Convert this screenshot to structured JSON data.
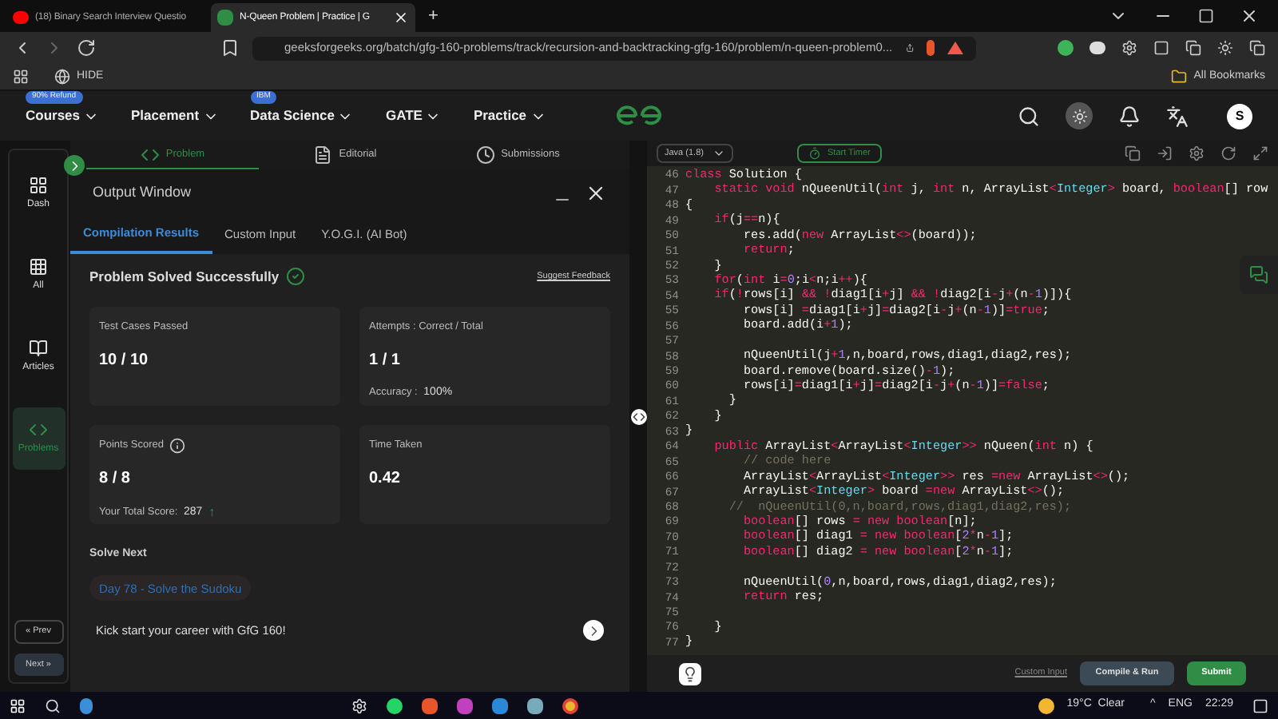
{
  "browser": {
    "tabs": [
      {
        "title": "(18) Binary Search Interview Questio",
        "selected": false
      },
      {
        "title": "N-Queen Problem | Practice | G",
        "selected": true
      }
    ],
    "new_tab": "+",
    "url": "geeksforgeeks.org/batch/gfg-160-problems/track/recursion-and-backtracking-gfg-160/problem/n-queen-problem0...",
    "bookmarks": {
      "left": "HIDE",
      "right": "All Bookmarks"
    }
  },
  "site_nav": {
    "items": [
      {
        "label": "Courses",
        "badge": "90% Refund"
      },
      {
        "label": "Placement"
      },
      {
        "label": "Data Science",
        "badge": "IBM"
      },
      {
        "label": "GATE"
      },
      {
        "label": "Practice"
      }
    ],
    "avatar": "S"
  },
  "sidebar": {
    "items": [
      {
        "label": "Dash",
        "kind": "dash",
        "selected": false
      },
      {
        "label": "All",
        "kind": "all",
        "selected": false
      },
      {
        "label": "Articles",
        "kind": "articles",
        "selected": false
      },
      {
        "label": "Problems",
        "kind": "problems",
        "selected": true
      }
    ],
    "prev": "« Prev",
    "next": "Next »"
  },
  "problem_tabs": [
    {
      "label": "Problem",
      "kind": "code",
      "selected": true
    },
    {
      "label": "Editorial",
      "kind": "doc",
      "selected": false
    },
    {
      "label": "Submissions",
      "kind": "clock",
      "selected": false
    }
  ],
  "output_window": {
    "title": "Output Window",
    "tabs": [
      {
        "label": "Compilation Results",
        "selected": true
      },
      {
        "label": "Custom Input",
        "selected": false
      },
      {
        "label": "Y.O.G.I. (AI Bot)",
        "selected": false
      }
    ],
    "status": "Problem Solved Successfully",
    "feedback": "Suggest Feedback",
    "cards": [
      {
        "label": "Test Cases Passed",
        "value": "10 / 10"
      },
      {
        "label": "Attempts : Correct / Total",
        "value": "1 / 1",
        "note_label": "Accuracy : ",
        "note_value": "100%"
      },
      {
        "label": "Points Scored",
        "value": "8 / 8",
        "info": true,
        "note_label": "Your Total Score: ",
        "note_value": "287",
        "arrow": "↑"
      },
      {
        "label": "Time Taken",
        "value": "0.42"
      }
    ],
    "solve_next": {
      "heading": "Solve Next",
      "chip": "Day 78 - Solve the Sudoku"
    },
    "promo": "Kick start your career with GfG 160!"
  },
  "editor": {
    "language": "Java (1.8)",
    "timer": "Start Timer",
    "lines": [
      {
        "number": "46",
        "segments": [
          {
            "kind": "keyword",
            "text": "class"
          },
          {
            "kind": "plain",
            "text": " Solution {"
          }
        ]
      },
      {
        "number": "47",
        "segments": [
          {
            "kind": "keyword",
            "text": "    static void"
          },
          {
            "kind": "plain",
            "text": " nQueenUtil("
          },
          {
            "kind": "keyword",
            "text": "int"
          },
          {
            "kind": "plain",
            "text": " j, "
          },
          {
            "kind": "keyword",
            "text": "int"
          },
          {
            "kind": "plain",
            "text": " n, ArrayList"
          },
          {
            "kind": "operator",
            "text": "<"
          },
          {
            "kind": "type",
            "text": "Integer"
          },
          {
            "kind": "operator",
            "text": ">"
          },
          {
            "kind": "plain",
            "text": " board, "
          },
          {
            "kind": "keyword",
            "text": "boolean"
          },
          {
            "kind": "plain",
            "text": "[] row"
          }
        ]
      },
      {
        "number": "48",
        "segments": [
          {
            "kind": "plain",
            "text": "{"
          }
        ]
      },
      {
        "number": "49",
        "segments": [
          {
            "kind": "keyword",
            "text": "    if"
          },
          {
            "kind": "plain",
            "text": "(j"
          },
          {
            "kind": "operator",
            "text": "=="
          },
          {
            "kind": "plain",
            "text": "n){"
          }
        ]
      },
      {
        "number": "50",
        "segments": [
          {
            "kind": "plain",
            "text": "        res.add("
          },
          {
            "kind": "keyword",
            "text": "new"
          },
          {
            "kind": "plain",
            "text": " ArrayList"
          },
          {
            "kind": "operator",
            "text": "<>"
          },
          {
            "kind": "plain",
            "text": "(board));"
          }
        ]
      },
      {
        "number": "51",
        "segments": [
          {
            "kind": "keyword",
            "text": "        return"
          },
          {
            "kind": "plain",
            "text": ";"
          }
        ]
      },
      {
        "number": "52",
        "segments": [
          {
            "kind": "plain",
            "text": "    }"
          }
        ]
      },
      {
        "number": "53",
        "segments": [
          {
            "kind": "keyword",
            "text": "    for"
          },
          {
            "kind": "plain",
            "text": "("
          },
          {
            "kind": "keyword",
            "text": "int"
          },
          {
            "kind": "plain",
            "text": " i"
          },
          {
            "kind": "operator",
            "text": "="
          },
          {
            "kind": "number",
            "text": "0"
          },
          {
            "kind": "plain",
            "text": ";i"
          },
          {
            "kind": "operator",
            "text": "<"
          },
          {
            "kind": "plain",
            "text": "n;i"
          },
          {
            "kind": "operator",
            "text": "++"
          },
          {
            "kind": "plain",
            "text": "){"
          }
        ]
      },
      {
        "number": "54",
        "segments": [
          {
            "kind": "keyword",
            "text": "    if"
          },
          {
            "kind": "plain",
            "text": "("
          },
          {
            "kind": "operator",
            "text": "!"
          },
          {
            "kind": "plain",
            "text": "rows[i] "
          },
          {
            "kind": "operator",
            "text": "&&"
          },
          {
            "kind": "operator",
            "text": " !"
          },
          {
            "kind": "plain",
            "text": "diag1[i"
          },
          {
            "kind": "operator",
            "text": "+"
          },
          {
            "kind": "plain",
            "text": "j] "
          },
          {
            "kind": "operator",
            "text": "&&"
          },
          {
            "kind": "operator",
            "text": " !"
          },
          {
            "kind": "plain",
            "text": "diag2[i"
          },
          {
            "kind": "operator",
            "text": "-"
          },
          {
            "kind": "plain",
            "text": "j"
          },
          {
            "kind": "operator",
            "text": "+"
          },
          {
            "kind": "plain",
            "text": "(n"
          },
          {
            "kind": "operator",
            "text": "-"
          },
          {
            "kind": "number",
            "text": "1"
          },
          {
            "kind": "plain",
            "text": ")]){"
          }
        ]
      },
      {
        "number": "55",
        "segments": [
          {
            "kind": "plain",
            "text": "        rows[i] "
          },
          {
            "kind": "operator",
            "text": "="
          },
          {
            "kind": "plain",
            "text": "diag1[i"
          },
          {
            "kind": "operator",
            "text": "+"
          },
          {
            "kind": "plain",
            "text": "j]"
          },
          {
            "kind": "operator",
            "text": "="
          },
          {
            "kind": "plain",
            "text": "diag2[i"
          },
          {
            "kind": "operator",
            "text": "-"
          },
          {
            "kind": "plain",
            "text": "j"
          },
          {
            "kind": "operator",
            "text": "+"
          },
          {
            "kind": "plain",
            "text": "(n"
          },
          {
            "kind": "operator",
            "text": "-"
          },
          {
            "kind": "number",
            "text": "1"
          },
          {
            "kind": "plain",
            "text": ")]"
          },
          {
            "kind": "operator",
            "text": "="
          },
          {
            "kind": "keyword",
            "text": "true"
          },
          {
            "kind": "plain",
            "text": ";"
          }
        ]
      },
      {
        "number": "56",
        "segments": [
          {
            "kind": "plain",
            "text": "        board.add(i"
          },
          {
            "kind": "operator",
            "text": "+"
          },
          {
            "kind": "number",
            "text": "1"
          },
          {
            "kind": "plain",
            "text": ");"
          }
        ]
      },
      {
        "number": "57"
      },
      {
        "number": "58",
        "segments": [
          {
            "kind": "plain",
            "text": "        nQueenUtil(j"
          },
          {
            "kind": "operator",
            "text": "+"
          },
          {
            "kind": "number",
            "text": "1"
          },
          {
            "kind": "plain",
            "text": ",n,board,rows,diag1,diag2,res);"
          }
        ]
      },
      {
        "number": "59",
        "segments": [
          {
            "kind": "plain",
            "text": "        board.remove(board.size()"
          },
          {
            "kind": "operator",
            "text": "-"
          },
          {
            "kind": "number",
            "text": "1"
          },
          {
            "kind": "plain",
            "text": ");"
          }
        ]
      },
      {
        "number": "60",
        "segments": [
          {
            "kind": "plain",
            "text": "        rows[i]"
          },
          {
            "kind": "operator",
            "text": "="
          },
          {
            "kind": "plain",
            "text": "diag1[i"
          },
          {
            "kind": "operator",
            "text": "+"
          },
          {
            "kind": "plain",
            "text": "j]"
          },
          {
            "kind": "operator",
            "text": "="
          },
          {
            "kind": "plain",
            "text": "diag2[i"
          },
          {
            "kind": "operator",
            "text": "-"
          },
          {
            "kind": "plain",
            "text": "j"
          },
          {
            "kind": "operator",
            "text": "+"
          },
          {
            "kind": "plain",
            "text": "(n"
          },
          {
            "kind": "operator",
            "text": "-"
          },
          {
            "kind": "number",
            "text": "1"
          },
          {
            "kind": "plain",
            "text": ")]"
          },
          {
            "kind": "operator",
            "text": "="
          },
          {
            "kind": "keyword",
            "text": "false"
          },
          {
            "kind": "plain",
            "text": ";"
          }
        ]
      },
      {
        "number": "61",
        "segments": [
          {
            "kind": "plain",
            "text": "      }"
          }
        ]
      },
      {
        "number": "62",
        "segments": [
          {
            "kind": "plain",
            "text": "    }"
          }
        ]
      },
      {
        "number": "63",
        "segments": [
          {
            "kind": "plain",
            "text": "}"
          }
        ]
      },
      {
        "number": "64",
        "segments": [
          {
            "kind": "keyword",
            "text": "    public"
          },
          {
            "kind": "plain",
            "text": " ArrayList"
          },
          {
            "kind": "operator",
            "text": "<"
          },
          {
            "kind": "plain",
            "text": "ArrayList"
          },
          {
            "kind": "operator",
            "text": "<"
          },
          {
            "kind": "type",
            "text": "Integer"
          },
          {
            "kind": "operator",
            "text": ">>"
          },
          {
            "kind": "plain",
            "text": " nQueen("
          },
          {
            "kind": "keyword",
            "text": "int"
          },
          {
            "kind": "plain",
            "text": " n) {"
          }
        ]
      },
      {
        "number": "65",
        "segments": [
          {
            "kind": "comment",
            "text": "        // code here"
          }
        ]
      },
      {
        "number": "66",
        "segments": [
          {
            "kind": "plain",
            "text": "        ArrayList"
          },
          {
            "kind": "operator",
            "text": "<"
          },
          {
            "kind": "plain",
            "text": "ArrayList"
          },
          {
            "kind": "operator",
            "text": "<"
          },
          {
            "kind": "type",
            "text": "Integer"
          },
          {
            "kind": "operator",
            "text": ">>"
          },
          {
            "kind": "plain",
            "text": " res "
          },
          {
            "kind": "operator",
            "text": "="
          },
          {
            "kind": "keyword",
            "text": "new"
          },
          {
            "kind": "plain",
            "text": " ArrayList"
          },
          {
            "kind": "operator",
            "text": "<>"
          },
          {
            "kind": "plain",
            "text": "();"
          }
        ]
      },
      {
        "number": "67",
        "segments": [
          {
            "kind": "plain",
            "text": "        ArrayList"
          },
          {
            "kind": "operator",
            "text": "<"
          },
          {
            "kind": "type",
            "text": "Integer"
          },
          {
            "kind": "operator",
            "text": ">"
          },
          {
            "kind": "plain",
            "text": " board "
          },
          {
            "kind": "operator",
            "text": "="
          },
          {
            "kind": "keyword",
            "text": "new"
          },
          {
            "kind": "plain",
            "text": " ArrayList"
          },
          {
            "kind": "operator",
            "text": "<>"
          },
          {
            "kind": "plain",
            "text": "();"
          }
        ]
      },
      {
        "number": "68",
        "segments": [
          {
            "kind": "comment",
            "text": "      //  nQueenUtil(0,n,board,rows,diag1,diag2,res);"
          }
        ]
      },
      {
        "number": "69",
        "segments": [
          {
            "kind": "keyword",
            "text": "        boolean"
          },
          {
            "kind": "plain",
            "text": "[] rows "
          },
          {
            "kind": "operator",
            "text": "="
          },
          {
            "kind": "keyword",
            "text": " new"
          },
          {
            "kind": "keyword",
            "text": " boolean"
          },
          {
            "kind": "plain",
            "text": "[n];"
          }
        ]
      },
      {
        "number": "70",
        "segments": [
          {
            "kind": "keyword",
            "text": "        boolean"
          },
          {
            "kind": "plain",
            "text": "[] diag1 "
          },
          {
            "kind": "operator",
            "text": "="
          },
          {
            "kind": "keyword",
            "text": " new"
          },
          {
            "kind": "keyword",
            "text": " boolean"
          },
          {
            "kind": "plain",
            "text": "["
          },
          {
            "kind": "number",
            "text": "2"
          },
          {
            "kind": "operator",
            "text": "*"
          },
          {
            "kind": "plain",
            "text": "n"
          },
          {
            "kind": "operator",
            "text": "-"
          },
          {
            "kind": "number",
            "text": "1"
          },
          {
            "kind": "plain",
            "text": "];"
          }
        ]
      },
      {
        "number": "71",
        "segments": [
          {
            "kind": "keyword",
            "text": "        boolean"
          },
          {
            "kind": "plain",
            "text": "[] diag2 "
          },
          {
            "kind": "operator",
            "text": "="
          },
          {
            "kind": "keyword",
            "text": " new"
          },
          {
            "kind": "keyword",
            "text": " boolean"
          },
          {
            "kind": "plain",
            "text": "["
          },
          {
            "kind": "number",
            "text": "2"
          },
          {
            "kind": "operator",
            "text": "*"
          },
          {
            "kind": "plain",
            "text": "n"
          },
          {
            "kind": "operator",
            "text": "-"
          },
          {
            "kind": "number",
            "text": "1"
          },
          {
            "kind": "plain",
            "text": "];"
          }
        ]
      },
      {
        "number": "72"
      },
      {
        "number": "73",
        "segments": [
          {
            "kind": "plain",
            "text": "        nQueenUtil("
          },
          {
            "kind": "number",
            "text": "0"
          },
          {
            "kind": "plain",
            "text": ",n,board,rows,diag1,diag2,res);"
          }
        ]
      },
      {
        "number": "74",
        "segments": [
          {
            "kind": "keyword",
            "text": "        return"
          },
          {
            "kind": "plain",
            "text": " res;"
          }
        ]
      },
      {
        "number": "75"
      },
      {
        "number": "76",
        "segments": [
          {
            "kind": "plain",
            "text": "    }"
          }
        ]
      },
      {
        "number": "77",
        "segments": [
          {
            "kind": "plain",
            "text": "}"
          }
        ]
      }
    ],
    "custom_input": "Custom Input",
    "compile": "Compile & Run",
    "submit": "Submit"
  },
  "taskbar": {
    "weather": "19°C  Clear",
    "caret": "^",
    "language": "ENG",
    "time": "22:29"
  }
}
